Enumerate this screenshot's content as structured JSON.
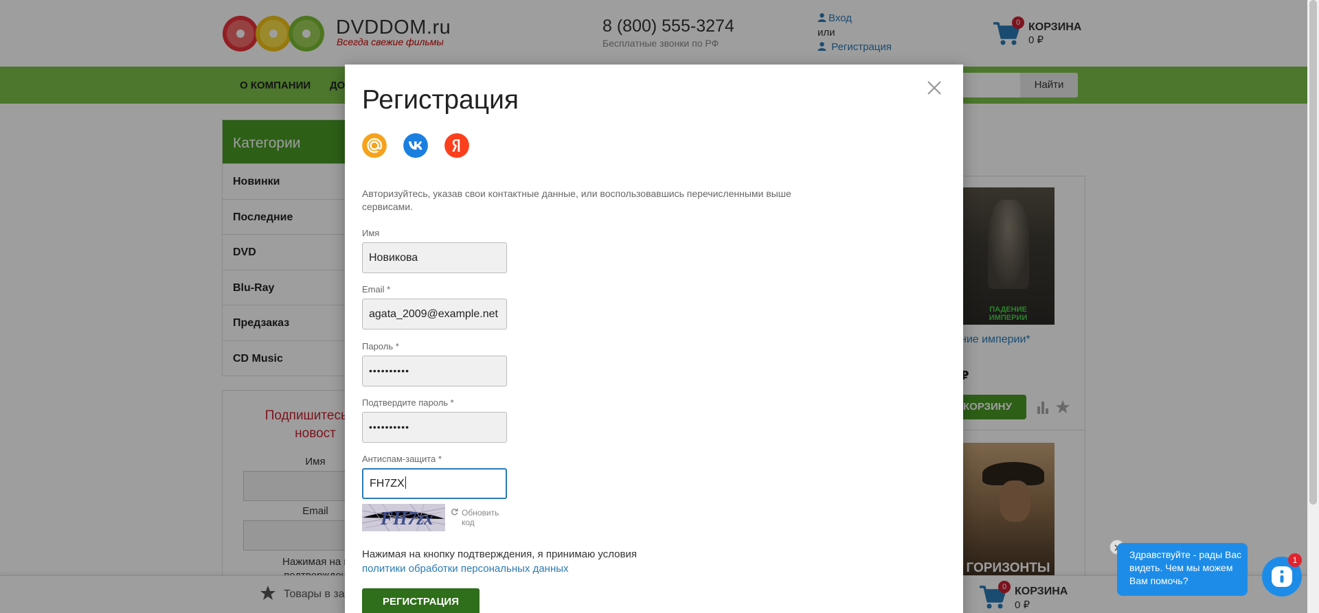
{
  "header": {
    "brand": "DVDDOM.ru",
    "tagline": "Всегда свежие фильмы",
    "phone": "8 (800) 555-3274",
    "phone_note": "Бесплатные звонки по РФ",
    "login": "Вход",
    "or": "или",
    "register": "Регистрация",
    "cart_label": "КОРЗИНА",
    "cart_sum": "0 ₽",
    "cart_count": "0"
  },
  "nav": {
    "items": [
      "О КОМПАНИИ",
      "ДО"
    ],
    "search_button": "Найти"
  },
  "categories": {
    "title": "Категории",
    "items": [
      "Новинки",
      "Последние",
      "DVD",
      "Blu-Ray",
      "Предзаказ",
      "CD Music"
    ]
  },
  "subscribe": {
    "title_line1": "Подпишитесь на",
    "title_line2": "новост",
    "name_label": "Имя",
    "email_label": "Email",
    "note_line1": "Нажимая на к",
    "note_line2": "подтвержден"
  },
  "products": {
    "p1_poster_text_1": "ПАДЕНИЕ",
    "p1_poster_text_2": "ИМПЕРИИ",
    "p1_title": "ние империи*",
    "p1_price": "₽",
    "buy": "КОРЗИНУ",
    "p2_poster_text": "ГОРИЗОНТЫ"
  },
  "footer": {
    "deferred": "Товары в за",
    "cart_label": "КОРЗИНА",
    "cart_sum": "0 ₽",
    "cart_count": "0"
  },
  "modal": {
    "title": "Регистрация",
    "socials": [
      "mailru-icon",
      "vk-icon",
      "yandex-icon"
    ],
    "intro": "Авторизуйтесь, указав свои контактные данные, или воспользовавшись перечисленными выше сервисами.",
    "fields": {
      "name": {
        "label": "Имя",
        "value": "Новикова"
      },
      "email": {
        "label": "Email *",
        "value": "agata_2009@example.net"
      },
      "password": {
        "label": "Пароль *",
        "value": "••••••••••"
      },
      "confirm": {
        "label": "Подтвердите пароль *",
        "value": "••••••••••"
      },
      "antispam": {
        "label": "Антиспам-защита *",
        "value": "FH7ZX"
      }
    },
    "captcha_text": "FH7zx",
    "refresh_line1": "Обновить",
    "refresh_line2": "код",
    "consent_text": "Нажимая на кнопку подтверждения, я принимаю условия ",
    "consent_link": "политики обработки персональных данных",
    "submit": "РЕГИСТРАЦИЯ"
  },
  "chat": {
    "message": "Здравствуйте - рады Вас видеть. Чем мы можем Вам помочь?",
    "unread": "1"
  },
  "colors": {
    "brand_green": "#7bc04a",
    "dark_green": "#2f6e1a",
    "link_blue": "#2a7ab5",
    "chat_blue": "#1d8ce8",
    "badge_red": "#c8202f"
  }
}
